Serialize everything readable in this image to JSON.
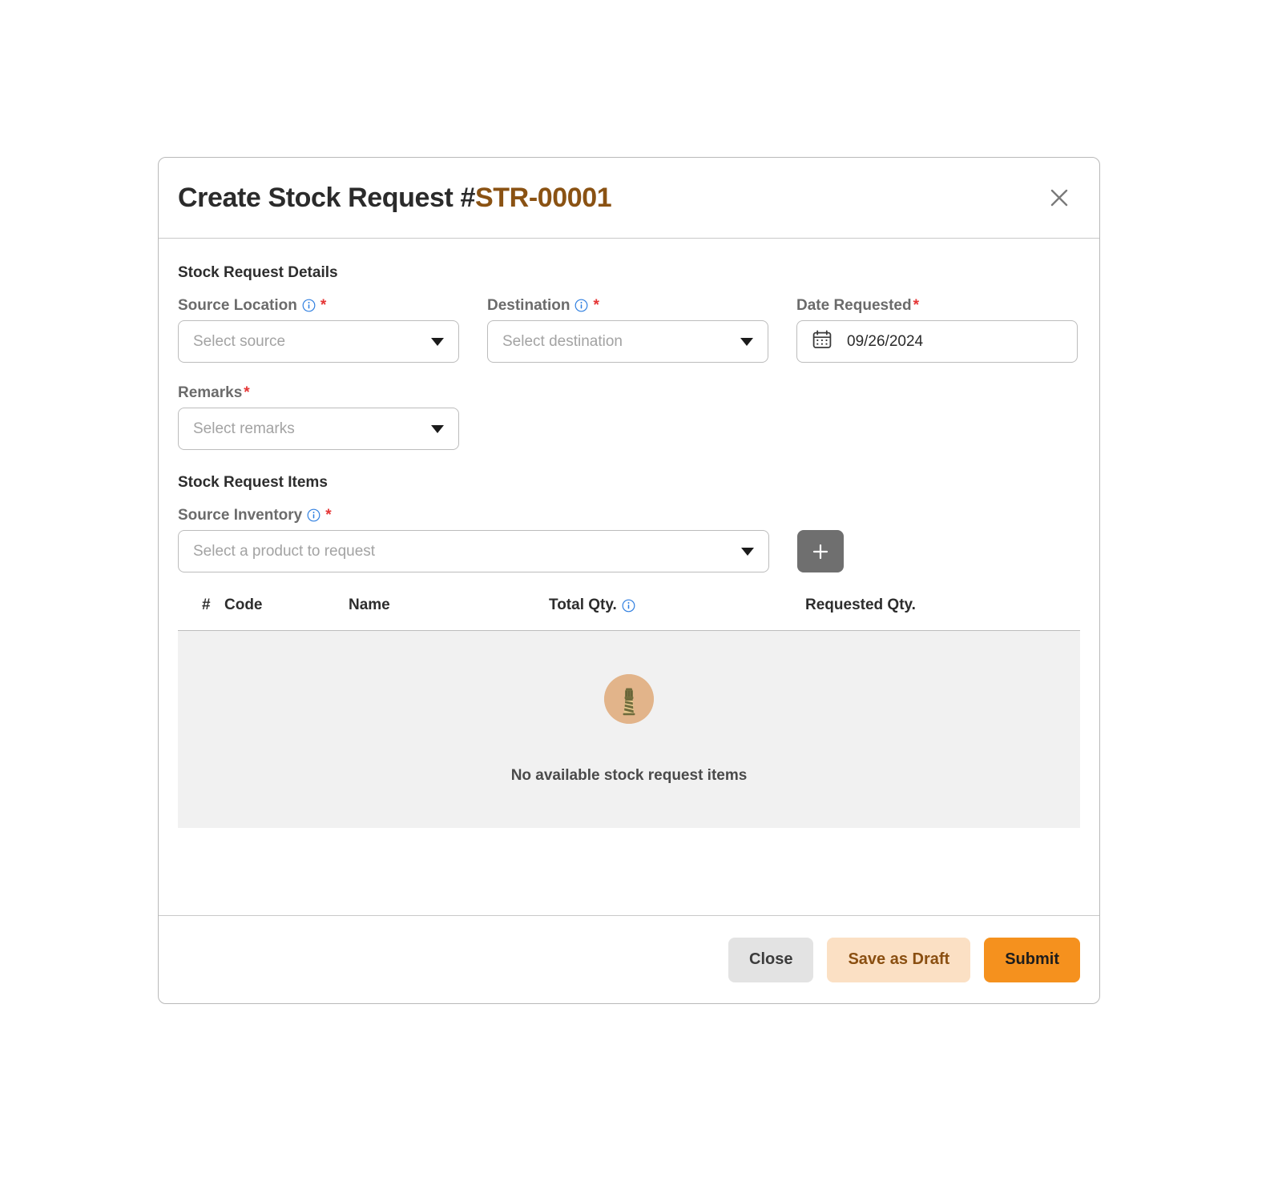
{
  "modal": {
    "title_prefix": "Create Stock Request #",
    "title_code": "STR-00001",
    "close_icon": "close-icon"
  },
  "details": {
    "section_title": "Stock Request Details",
    "source_location": {
      "label": "Source Location",
      "required_mark": "*",
      "info_icon": "info-icon",
      "placeholder": "Select source",
      "value": ""
    },
    "destination": {
      "label": "Destination",
      "required_mark": "*",
      "info_icon": "info-icon",
      "placeholder": "Select destination",
      "value": ""
    },
    "date_requested": {
      "label": "Date Requested",
      "required_mark": "*",
      "calendar_icon": "calendar-icon",
      "value": "09/26/2024"
    },
    "remarks": {
      "label": "Remarks",
      "required_mark": "*",
      "placeholder": "Select remarks",
      "value": ""
    }
  },
  "items": {
    "section_title": "Stock Request Items",
    "source_inventory": {
      "label": "Source Inventory",
      "required_mark": "*",
      "info_icon": "info-icon",
      "placeholder": "Select a product to request",
      "value": ""
    },
    "add_button_icon": "plus-icon",
    "table": {
      "columns": [
        "#",
        "Code",
        "Name",
        "Total Qty.",
        "Requested Qty."
      ],
      "total_qty_info_icon": "info-icon",
      "rows": [],
      "empty_icon": "lighthouse-icon",
      "empty_message": "No available stock request items"
    }
  },
  "footer": {
    "close_label": "Close",
    "draft_label": "Save as Draft",
    "submit_label": "Submit"
  },
  "colors": {
    "accent_orange": "#f5911e",
    "accent_brown": "#8a5213",
    "draft_bg": "#fbe0c4",
    "required_red": "#e53535",
    "info_blue": "#2f7fe0",
    "empty_bg": "#f1f1f1"
  }
}
